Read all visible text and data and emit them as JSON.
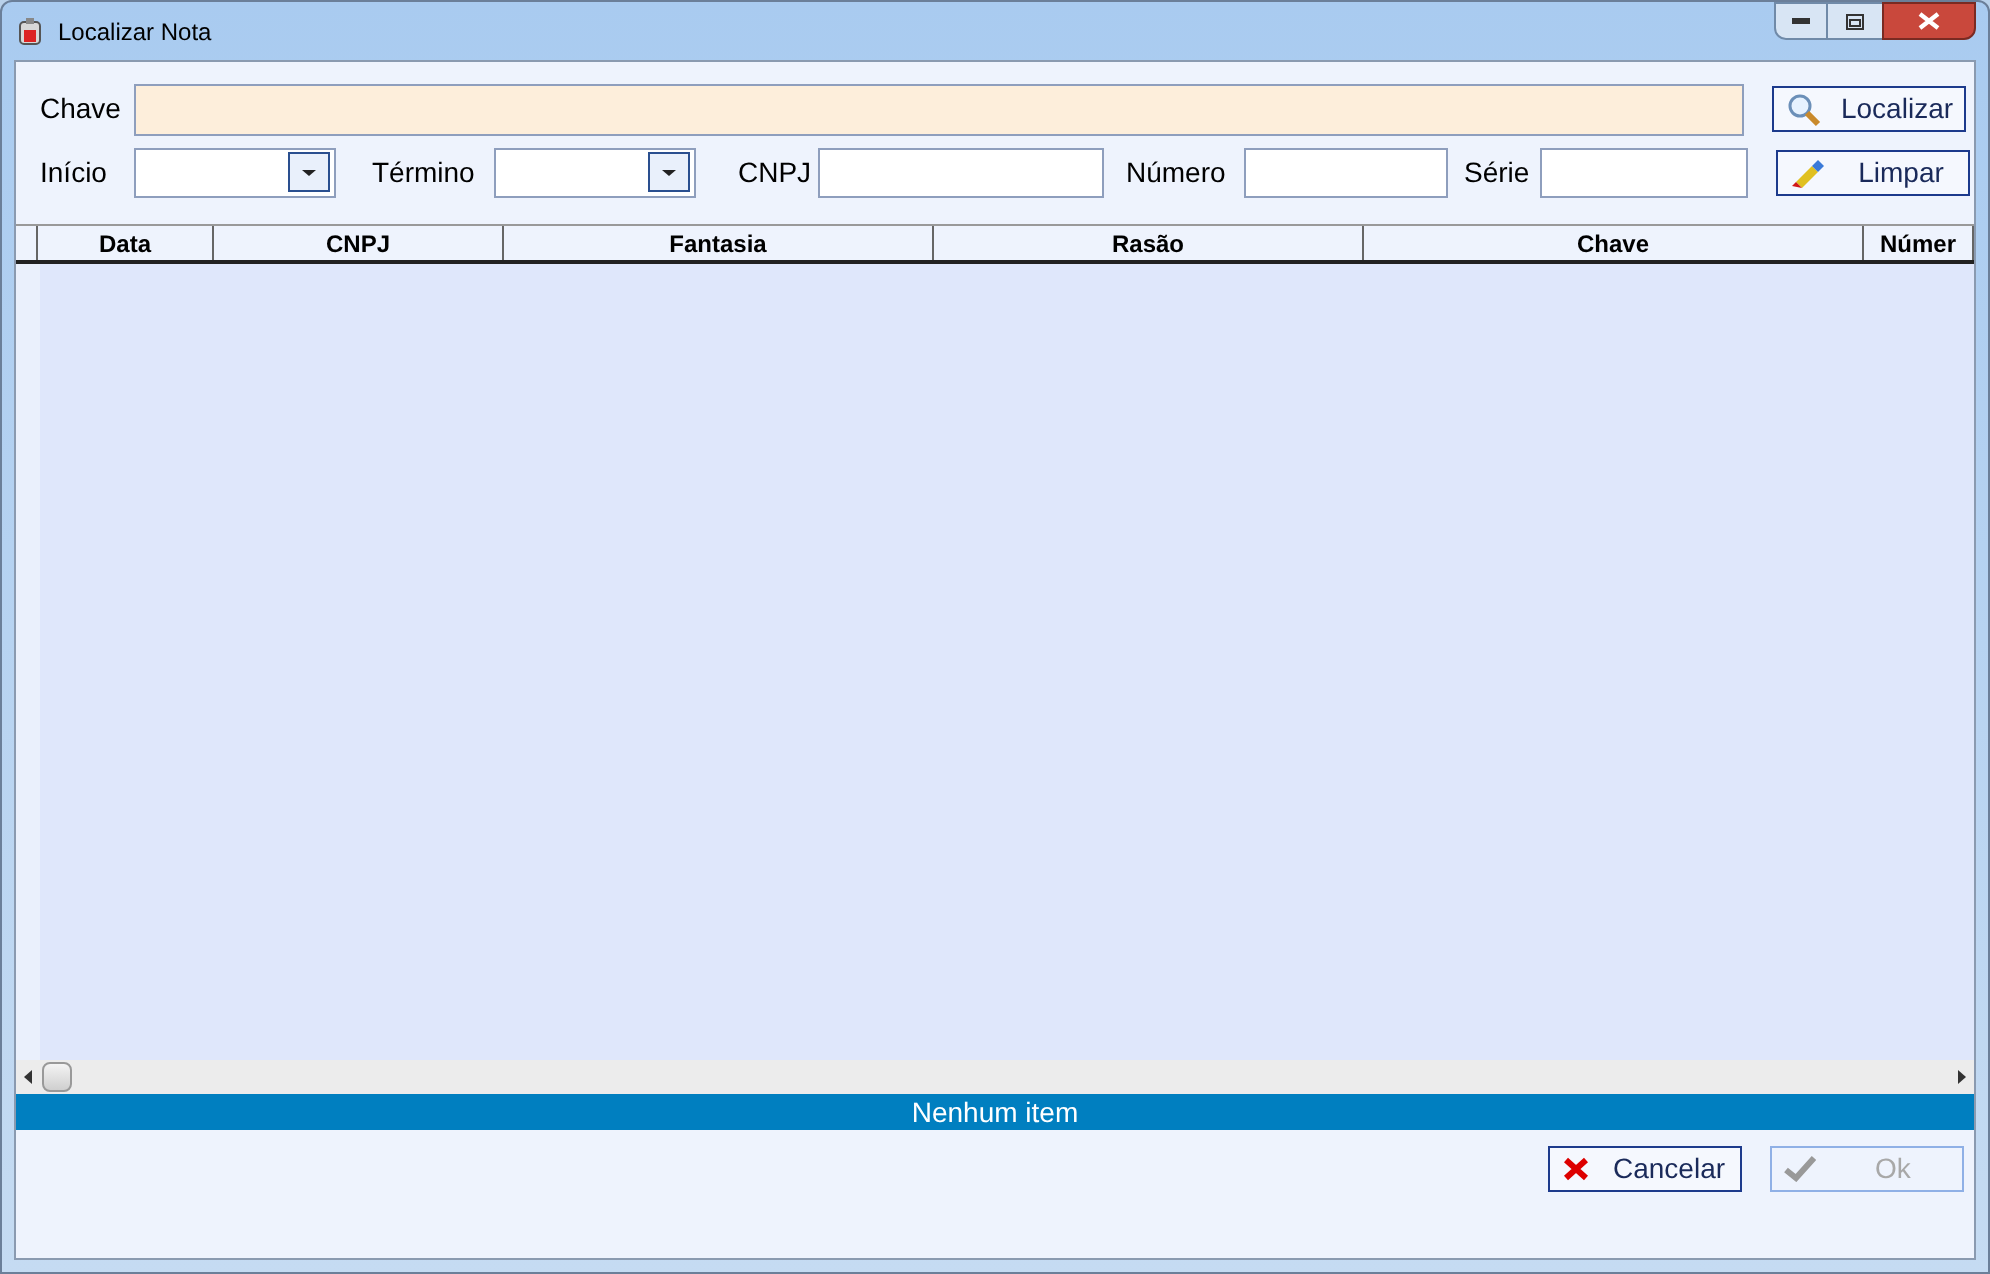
{
  "window": {
    "title": "Localizar Nota"
  },
  "filters": {
    "chave_label": "Chave",
    "inicio_label": "Início",
    "termino_label": "Término",
    "cnpj_label": "CNPJ",
    "numero_label": "Número",
    "serie_label": "Série"
  },
  "buttons": [
    {
      "label": "Localizar",
      "kind": "search",
      "disabled": false
    },
    {
      "label": "Limpar",
      "kind": "clear",
      "disabled": false
    }
  ],
  "table": {
    "columns": [
      "Data",
      "CNPJ",
      "Fantasia",
      "Rasão",
      "Chave",
      "Númer"
    ]
  },
  "status_bar": "Nenhum item",
  "footer_buttons": [
    {
      "label": "Cancelar",
      "kind": "cancel",
      "disabled": false
    },
    {
      "label": "Ok",
      "kind": "ok",
      "disabled": true
    }
  ]
}
